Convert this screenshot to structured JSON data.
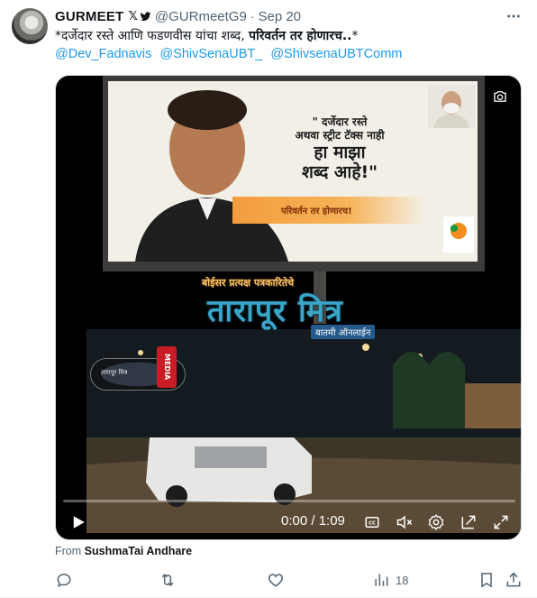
{
  "tweet": {
    "author_name": "GURMEET",
    "badge_icons": [
      "x-logo-icon",
      "twitter-bird-icon"
    ],
    "handle": "@GURmeetG9",
    "separator": "·",
    "date": "Sep 20",
    "text_part1": "*दर्जेदार रस्ते आणि फडणवीस यांचा शब्द,  ",
    "text_part2": "परिवर्तन तर होणारच..",
    "text_part3": "*",
    "mentions": [
      "@Dev_Fadnavis",
      "@ShivSenaUBT_",
      "@ShivsenaUBTComm"
    ],
    "more_icon": "more-horizontal-icon"
  },
  "video": {
    "billboard_line1": "\" दर्जेदार रस्ते",
    "billboard_line2": "अथवा स्ट्रीट टॅक्स नाही",
    "billboard_line3": "हा माझा",
    "billboard_line4": "शब्द आहे!\"",
    "billboard_strip": "परिवर्तन तर होणारच!",
    "watermark_top": "बोईसर प्रत्यक्ष पत्रकारितेचे",
    "watermark_title": "तारापूर मित्र",
    "watermark_sub": "बातमी ऑनलाईन",
    "media_tag": "MEDIA",
    "logo_text": "तारापूर मित्र",
    "time": "0:00 / 1:09",
    "icons": [
      "play-icon",
      "captions-icon",
      "mute-icon",
      "settings-icon",
      "pop-out-icon",
      "fullscreen-icon",
      "camera-icon"
    ]
  },
  "attribution": {
    "prefix": "From ",
    "source": "SushmaTai Andhare"
  },
  "actions": {
    "reply_count": "",
    "retweet_count": "",
    "like_count": "",
    "views_count": "18"
  },
  "colors": {
    "link": "#1d9bf0",
    "muted": "#536471",
    "text": "#0f1419"
  }
}
